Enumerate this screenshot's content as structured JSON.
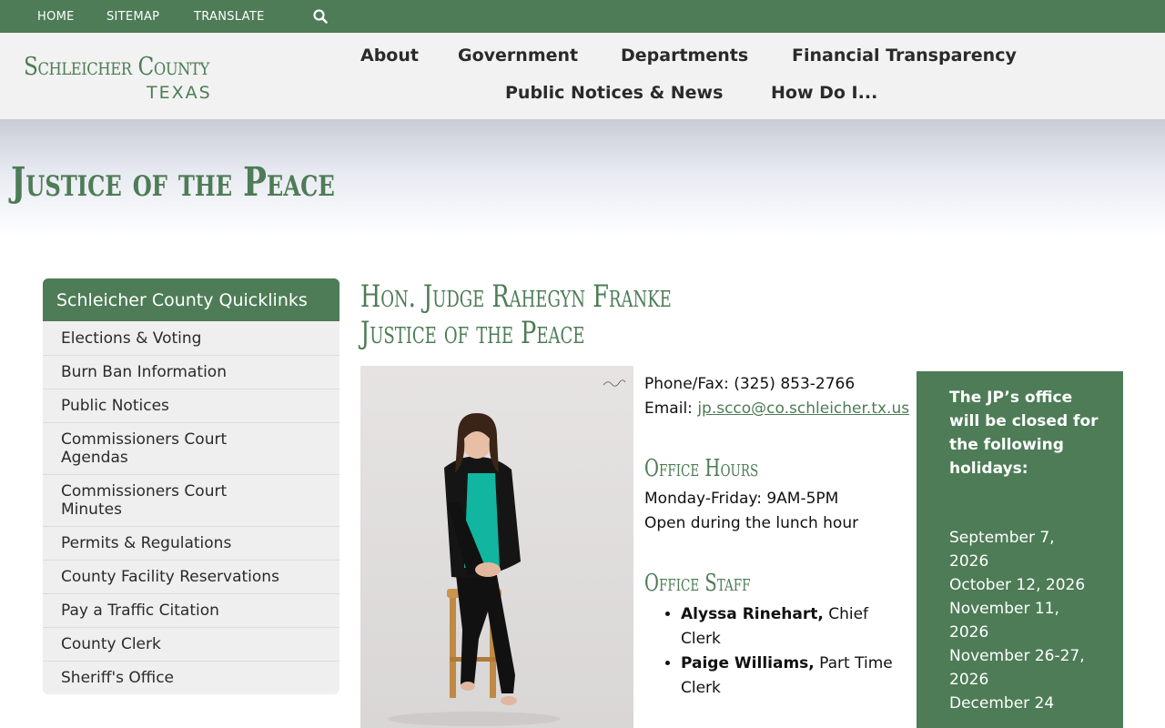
{
  "topbar": {
    "links": [
      "HOME",
      "SITEMAP",
      "TRANSLATE"
    ],
    "search_icon": "search-icon"
  },
  "header": {
    "logo_main": "Schleicher County",
    "logo_sub": "TEXAS",
    "nav": [
      "About",
      "Government",
      "Departments",
      "Financial Transparency",
      "Public Notices & News",
      "How Do I..."
    ]
  },
  "hero": {
    "title": "Justice of the Peace"
  },
  "quicklinks": {
    "title": "Schleicher County Quicklinks",
    "items": [
      "Elections & Voting",
      "Burn Ban Information",
      "Public Notices",
      "Commissioners Court Agendas",
      "Commissioners Court Minutes",
      "Permits & Regulations",
      "County Facility Reservations",
      "Pay a Traffic Citation",
      "County Clerk",
      "Sheriff's Office"
    ]
  },
  "main": {
    "judge_line1": "Hon. Judge Rahegyn Franke",
    "judge_line2": "Justice of the Peace",
    "phone_label": "Phone/Fax:",
    "phone_value": "(325) 853-2766",
    "email_label": "Email:",
    "email_value": "jp.scco@co.schleicher.tx.us",
    "hours_title": "Office Hours",
    "hours_line1": "Monday-Friday: 9AM-5PM",
    "hours_line2": "Open during the lunch hour",
    "staff_title": "Office Staff",
    "staff": [
      {
        "name": "Alyssa Rinehart,",
        "role": "Chief Clerk"
      },
      {
        "name": "Paige Williams,",
        "role": "Part Time Clerk"
      }
    ]
  },
  "notice": {
    "heading": "The JP’s office will be closed for the following holidays:",
    "dates": [
      "September 7, 2026",
      "October 12, 2026",
      "November 11, 2026",
      "November 26-27, 2026",
      "December 24"
    ]
  }
}
